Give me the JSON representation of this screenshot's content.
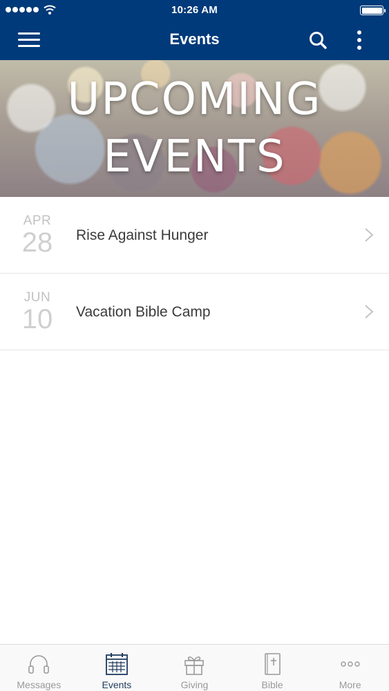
{
  "status_bar": {
    "time": "10:26 AM"
  },
  "header": {
    "title": "Events",
    "color": "#003a7a"
  },
  "banner": {
    "line1": "UPCOMING",
    "line2": "EVENTS"
  },
  "events": [
    {
      "month": "APR",
      "day": "28",
      "title": "Rise Against Hunger"
    },
    {
      "month": "JUN",
      "day": "10",
      "title": "Vacation Bible Camp"
    }
  ],
  "tabs": [
    {
      "label": "Messages",
      "icon": "headphones-icon"
    },
    {
      "label": "Events",
      "icon": "calendar-icon",
      "active": true
    },
    {
      "label": "Giving",
      "icon": "gift-icon"
    },
    {
      "label": "Bible",
      "icon": "bible-icon"
    },
    {
      "label": "More",
      "icon": "more-dots-icon"
    }
  ]
}
